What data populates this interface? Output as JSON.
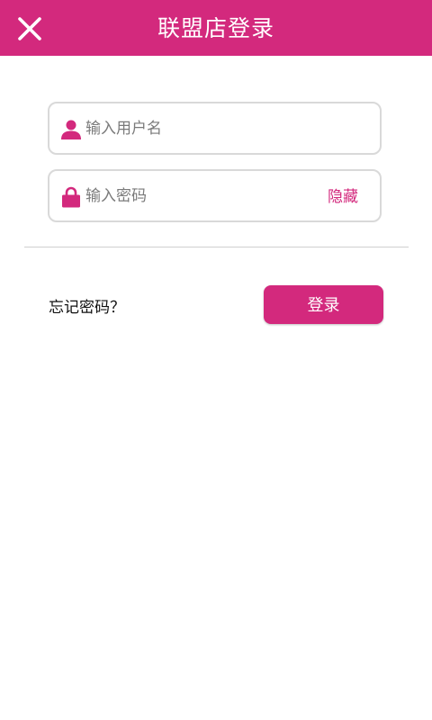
{
  "header": {
    "title": "联盟店登录",
    "close_icon": "close-icon"
  },
  "form": {
    "username": {
      "placeholder": "输入用户名",
      "value": "",
      "icon": "user-icon"
    },
    "password": {
      "placeholder": "输入密码",
      "value": "",
      "icon": "lock-icon",
      "toggle_label": "隐藏"
    },
    "forgot_label": "忘记密码？",
    "login_label": "登录"
  },
  "colors": {
    "accent": "#d3297d",
    "divider": "#cfcfcf",
    "field_border": "#d9d9d9"
  }
}
